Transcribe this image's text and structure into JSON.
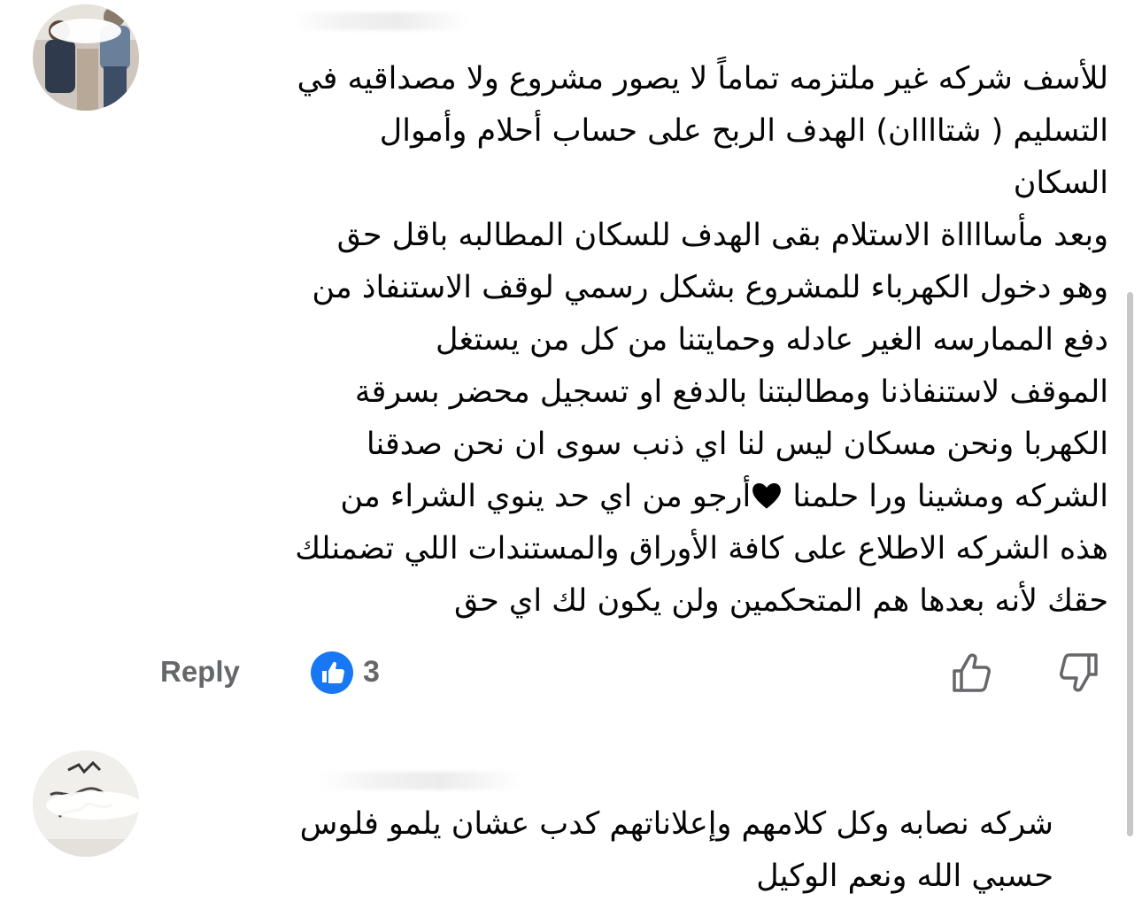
{
  "comments": [
    {
      "author_name": "",
      "lines": [
        "للأسف شركه غير ملتزمه تماماً لا يصور مشروع ولا مصداقيه في",
        "التسليم ( شتاااان) الهدف الربح على حساب أحلام وأموال",
        "السكان",
        "وبعد مأسااااة الاستلام بقى الهدف للسكان المطالبه باقل  حق",
        "وهو دخول الكهرباء للمشروع بشكل رسمي  لوقف الاستنفاذ من",
        "دفع الممارسه الغير عادله  وحمايتنا من كل من يستغل",
        "الموقف لاستنفاذنا ومطالبتنا بالدفع او تسجيل محضر بسرقة",
        "الكهربا ونحن مسكان ليس لنا اي ذنب سوى ان نحن صدقنا",
        "هذه الشركه الاطلاع على كافة الأوراق والمستندات اللي تضمنلك",
        "حقك لأنه بعدها هم المتحكمين ولن يكون لك اي حق"
      ],
      "heart_line_before": "الشركه ومشينا ورا حلمنا",
      "heart_line_after": "أرجو من اي حد ينوي الشراء من",
      "heart_icon": "black-heart-emoji",
      "reply_label": "Reply",
      "like_count": "3"
    },
    {
      "author_name": "",
      "lines": [
        "شركه نصابه وكل كلامهم وإعلاناتهم كدب عشان يلمو فلوس",
        "حسبي الله ونعم الوكيل"
      ]
    }
  ],
  "colors": {
    "text": "#050505",
    "secondary": "#65676b",
    "like_blue": "#1877f2",
    "scrollbar": "#c7c7c7"
  }
}
